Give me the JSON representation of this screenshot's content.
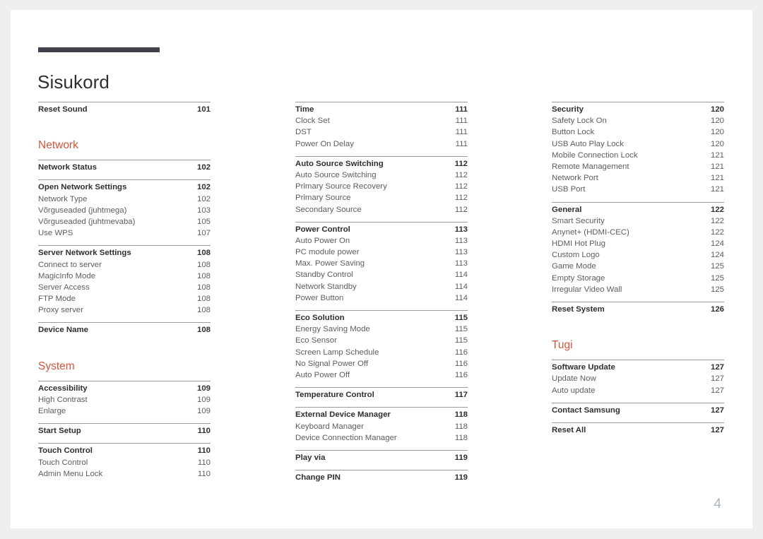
{
  "document": {
    "title": "Sisukord",
    "page_number": "4",
    "accent_color": "#d4553a",
    "rule_color": "#41414e",
    "page_number_color": "#a9b4bf"
  },
  "columns": [
    {
      "blocks": [
        {
          "type": "group",
          "rows": [
            {
              "label": "Reset Sound",
              "page": "101",
              "level": "head"
            }
          ]
        },
        {
          "type": "section",
          "title": "Network"
        },
        {
          "type": "group",
          "rows": [
            {
              "label": "Network Status",
              "page": "102",
              "level": "head"
            }
          ]
        },
        {
          "type": "group",
          "rows": [
            {
              "label": "Open Network Settings",
              "page": "102",
              "level": "head"
            },
            {
              "label": "Network Type",
              "page": "102",
              "level": "sub"
            },
            {
              "label": "Võrguseaded (juhtmega)",
              "page": "103",
              "level": "sub"
            },
            {
              "label": "Võrguseaded (juhtmevaba)",
              "page": "105",
              "level": "sub"
            },
            {
              "label": "Use WPS",
              "page": "107",
              "level": "sub"
            }
          ]
        },
        {
          "type": "group",
          "rows": [
            {
              "label": "Server Network Settings",
              "page": "108",
              "level": "head"
            },
            {
              "label": "Connect to server",
              "page": "108",
              "level": "sub"
            },
            {
              "label": "MagicInfo Mode",
              "page": "108",
              "level": "sub"
            },
            {
              "label": "Server Access",
              "page": "108",
              "level": "sub"
            },
            {
              "label": "FTP Mode",
              "page": "108",
              "level": "sub"
            },
            {
              "label": "Proxy server",
              "page": "108",
              "level": "sub"
            }
          ]
        },
        {
          "type": "group",
          "rows": [
            {
              "label": "Device Name",
              "page": "108",
              "level": "head"
            }
          ]
        },
        {
          "type": "section",
          "title": "System"
        },
        {
          "type": "group",
          "rows": [
            {
              "label": "Accessibility",
              "page": "109",
              "level": "head"
            },
            {
              "label": "High Contrast",
              "page": "109",
              "level": "sub"
            },
            {
              "label": "Enlarge",
              "page": "109",
              "level": "sub"
            }
          ]
        },
        {
          "type": "group",
          "rows": [
            {
              "label": "Start Setup",
              "page": "110",
              "level": "head"
            }
          ]
        },
        {
          "type": "group",
          "rows": [
            {
              "label": "Touch Control",
              "page": "110",
              "level": "head"
            },
            {
              "label": "Touch Control",
              "page": "110",
              "level": "sub"
            },
            {
              "label": "Admin Menu Lock",
              "page": "110",
              "level": "sub"
            }
          ]
        }
      ]
    },
    {
      "blocks": [
        {
          "type": "group",
          "rows": [
            {
              "label": "Time",
              "page": "111",
              "level": "head"
            },
            {
              "label": "Clock Set",
              "page": "111",
              "level": "sub"
            },
            {
              "label": "DST",
              "page": "111",
              "level": "sub"
            },
            {
              "label": "Power On Delay",
              "page": "111",
              "level": "sub"
            }
          ]
        },
        {
          "type": "group",
          "rows": [
            {
              "label": "Auto Source Switching",
              "page": "112",
              "level": "head"
            },
            {
              "label": "Auto Source Switching",
              "page": "112",
              "level": "sub"
            },
            {
              "label": "Primary Source Recovery",
              "page": "112",
              "level": "sub"
            },
            {
              "label": "Primary Source",
              "page": "112",
              "level": "sub"
            },
            {
              "label": "Secondary Source",
              "page": "112",
              "level": "sub"
            }
          ]
        },
        {
          "type": "group",
          "rows": [
            {
              "label": "Power Control",
              "page": "113",
              "level": "head"
            },
            {
              "label": "Auto Power On",
              "page": "113",
              "level": "sub"
            },
            {
              "label": "PC module power",
              "page": "113",
              "level": "sub"
            },
            {
              "label": "Max. Power Saving",
              "page": "113",
              "level": "sub"
            },
            {
              "label": "Standby Control",
              "page": "114",
              "level": "sub"
            },
            {
              "label": "Network Standby",
              "page": "114",
              "level": "sub"
            },
            {
              "label": "Power Button",
              "page": "114",
              "level": "sub"
            }
          ]
        },
        {
          "type": "group",
          "rows": [
            {
              "label": "Eco Solution",
              "page": "115",
              "level": "head"
            },
            {
              "label": "Energy Saving Mode",
              "page": "115",
              "level": "sub"
            },
            {
              "label": "Eco Sensor",
              "page": "115",
              "level": "sub"
            },
            {
              "label": "Screen Lamp Schedule",
              "page": "116",
              "level": "sub"
            },
            {
              "label": "No Signal Power Off",
              "page": "116",
              "level": "sub"
            },
            {
              "label": "Auto Power Off",
              "page": "116",
              "level": "sub"
            }
          ]
        },
        {
          "type": "group",
          "rows": [
            {
              "label": "Temperature Control",
              "page": "117",
              "level": "head"
            }
          ]
        },
        {
          "type": "group",
          "rows": [
            {
              "label": "External Device Manager",
              "page": "118",
              "level": "head"
            },
            {
              "label": "Keyboard Manager",
              "page": "118",
              "level": "sub"
            },
            {
              "label": "Device Connection Manager",
              "page": "118",
              "level": "sub"
            }
          ]
        },
        {
          "type": "group",
          "rows": [
            {
              "label": "Play via",
              "page": "119",
              "level": "head"
            }
          ]
        },
        {
          "type": "group",
          "rows": [
            {
              "label": "Change PIN",
              "page": "119",
              "level": "head"
            }
          ]
        }
      ]
    },
    {
      "blocks": [
        {
          "type": "group",
          "rows": [
            {
              "label": "Security",
              "page": "120",
              "level": "head"
            },
            {
              "label": "Safety Lock On",
              "page": "120",
              "level": "sub"
            },
            {
              "label": "Button Lock",
              "page": "120",
              "level": "sub"
            },
            {
              "label": "USB Auto Play Lock",
              "page": "120",
              "level": "sub"
            },
            {
              "label": "Mobile Connection Lock",
              "page": "121",
              "level": "sub"
            },
            {
              "label": "Remote Management",
              "page": "121",
              "level": "sub"
            },
            {
              "label": "Network Port",
              "page": "121",
              "level": "sub"
            },
            {
              "label": "USB Port",
              "page": "121",
              "level": "sub"
            }
          ]
        },
        {
          "type": "group",
          "rows": [
            {
              "label": "General",
              "page": "122",
              "level": "head"
            },
            {
              "label": "Smart Security",
              "page": "122",
              "level": "sub"
            },
            {
              "label": "Anynet+ (HDMI-CEC)",
              "page": "122",
              "level": "sub"
            },
            {
              "label": "HDMI Hot Plug",
              "page": "124",
              "level": "sub"
            },
            {
              "label": "Custom Logo",
              "page": "124",
              "level": "sub"
            },
            {
              "label": "Game Mode",
              "page": "125",
              "level": "sub"
            },
            {
              "label": "Empty Storage",
              "page": "125",
              "level": "sub"
            },
            {
              "label": "Irregular Video Wall",
              "page": "125",
              "level": "sub"
            }
          ]
        },
        {
          "type": "group",
          "rows": [
            {
              "label": "Reset System",
              "page": "126",
              "level": "head"
            }
          ]
        },
        {
          "type": "section",
          "title": "Tugi"
        },
        {
          "type": "group",
          "rows": [
            {
              "label": "Software Update",
              "page": "127",
              "level": "head"
            },
            {
              "label": "Update Now",
              "page": "127",
              "level": "sub"
            },
            {
              "label": "Auto update",
              "page": "127",
              "level": "sub"
            }
          ]
        },
        {
          "type": "group",
          "rows": [
            {
              "label": "Contact Samsung",
              "page": "127",
              "level": "head"
            }
          ]
        },
        {
          "type": "group",
          "rows": [
            {
              "label": "Reset All",
              "page": "127",
              "level": "head"
            }
          ]
        }
      ]
    }
  ]
}
